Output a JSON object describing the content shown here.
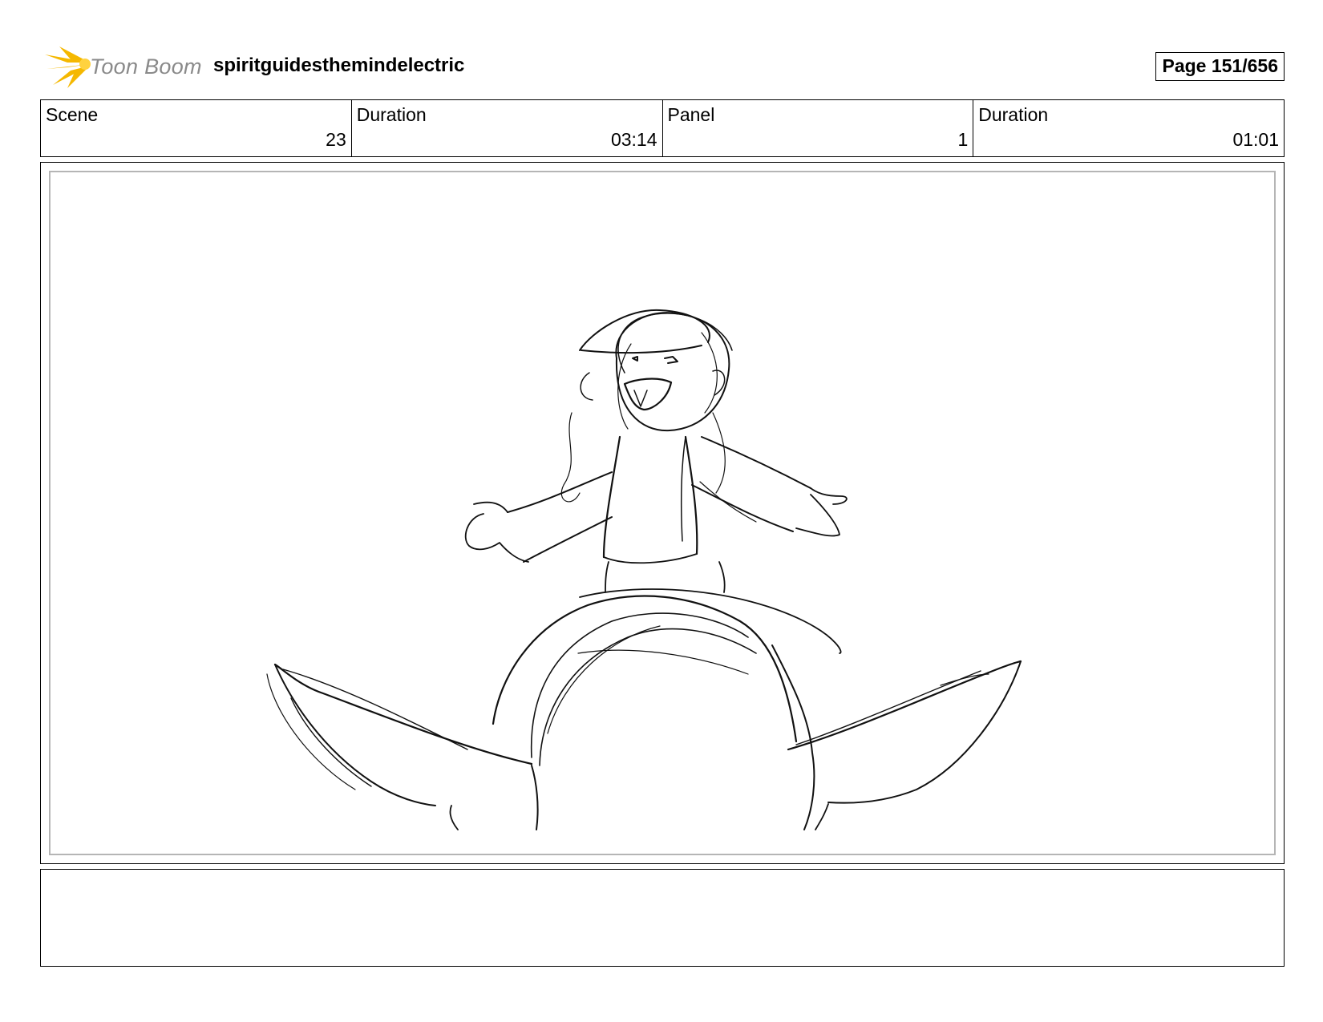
{
  "header": {
    "logo_text": "Toon Boom",
    "project_title": "spiritguidesthemindelectric",
    "page_label": "Page 151/656"
  },
  "info": [
    {
      "label": "Scene",
      "value": "23"
    },
    {
      "label": "Duration",
      "value": "03:14"
    },
    {
      "label": "Panel",
      "value": "1"
    },
    {
      "label": "Duration",
      "value": "01:01"
    }
  ],
  "panel": {
    "drawing": "rough pencil sketch: smiling character with open arms standing behind the top of a large head with two pointed ears in the foreground"
  },
  "notes": {
    "text": ""
  },
  "colors": {
    "logo_accent": "#f5b800",
    "logo_text": "#8a8a8a",
    "frame_border": "#b5b5b5"
  }
}
